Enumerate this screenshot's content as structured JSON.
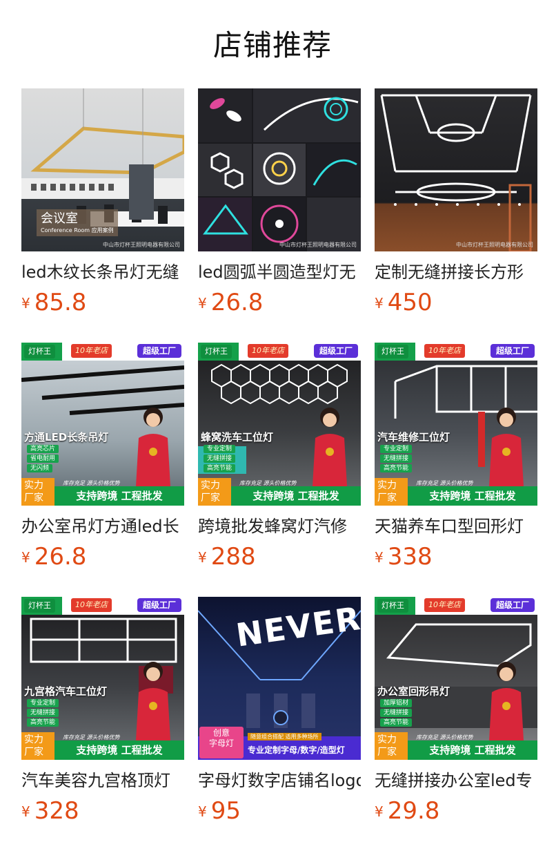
{
  "page": {
    "title": "店铺推荐"
  },
  "colors": {
    "price": "#e04a14",
    "brand_green": "#119c46",
    "factory_purple": "#5b2fd8",
    "years_red": "#e33b2b",
    "badge_orange": "#f39a18"
  },
  "common_banner": {
    "brand": "灯杯王",
    "years": "10年老店",
    "factory": "超级工厂",
    "strength_line1": "实力",
    "strength_line2": "厂家",
    "support": "支持跨境 工程批发",
    "stock_note": "库存充足  源头价格优势"
  },
  "products": [
    {
      "name": "led木纹长条吊灯无缝",
      "currency": "¥",
      "price": "85.8",
      "image": {
        "style": "photo-conference",
        "caption_main": "会议室",
        "caption_sub": "Conference Room 应用案例",
        "watermark": "中山市灯杯王照明电器有限公司"
      }
    },
    {
      "name": "led圆弧半圆造型灯无",
      "currency": "¥",
      "price": "26.8",
      "image": {
        "style": "photo-collage",
        "watermark": "中山市灯杯王照明电器有限公司"
      }
    },
    {
      "name": "定制无缝拼接长方形",
      "currency": "¥",
      "price": "450",
      "image": {
        "style": "photo-court",
        "watermark": "中山市灯杯王照明电器有限公司"
      }
    },
    {
      "name": "办公室吊灯方通led长",
      "currency": "¥",
      "price": "26.8",
      "image": {
        "style": "banner",
        "title": "方通LED长条吊灯",
        "features": [
          "高亮芯片",
          "省电耐用",
          "无闪频"
        ]
      }
    },
    {
      "name": "跨境批发蜂窝灯汽修",
      "currency": "¥",
      "price": "288",
      "image": {
        "style": "banner",
        "title": "蜂窝洗车工位灯",
        "features": [
          "专业定制",
          "无缝拼接",
          "高亮节能"
        ]
      }
    },
    {
      "name": "天猫养车口型回形灯",
      "currency": "¥",
      "price": "338",
      "image": {
        "style": "banner",
        "title": "汽车维修工位灯",
        "features": [
          "专业定制",
          "无缝拼接",
          "高亮节能"
        ]
      }
    },
    {
      "name": "汽车美容九宫格顶灯",
      "currency": "¥",
      "price": "328",
      "image": {
        "style": "banner",
        "title": "九宫格汽车工位灯",
        "features": [
          "专业定制",
          "无缝拼接",
          "高亮节能"
        ]
      }
    },
    {
      "name": "字母灯数字店铺名logo",
      "currency": "¥",
      "price": "95",
      "image": {
        "style": "letters",
        "big_text": "NEVER GIVE",
        "tag_line1": "创意",
        "tag_line2": "字母灯",
        "top_note": "随意组合搭配 适用多种场所",
        "bar_text": "专业定制字母/数字/造型灯"
      }
    },
    {
      "name": "无缝拼接办公室led专",
      "currency": "¥",
      "price": "29.8",
      "image": {
        "style": "banner",
        "title": "办公室回形吊灯",
        "features": [
          "加厚铝材",
          "无缝拼接",
          "高亮节能"
        ]
      }
    }
  ]
}
